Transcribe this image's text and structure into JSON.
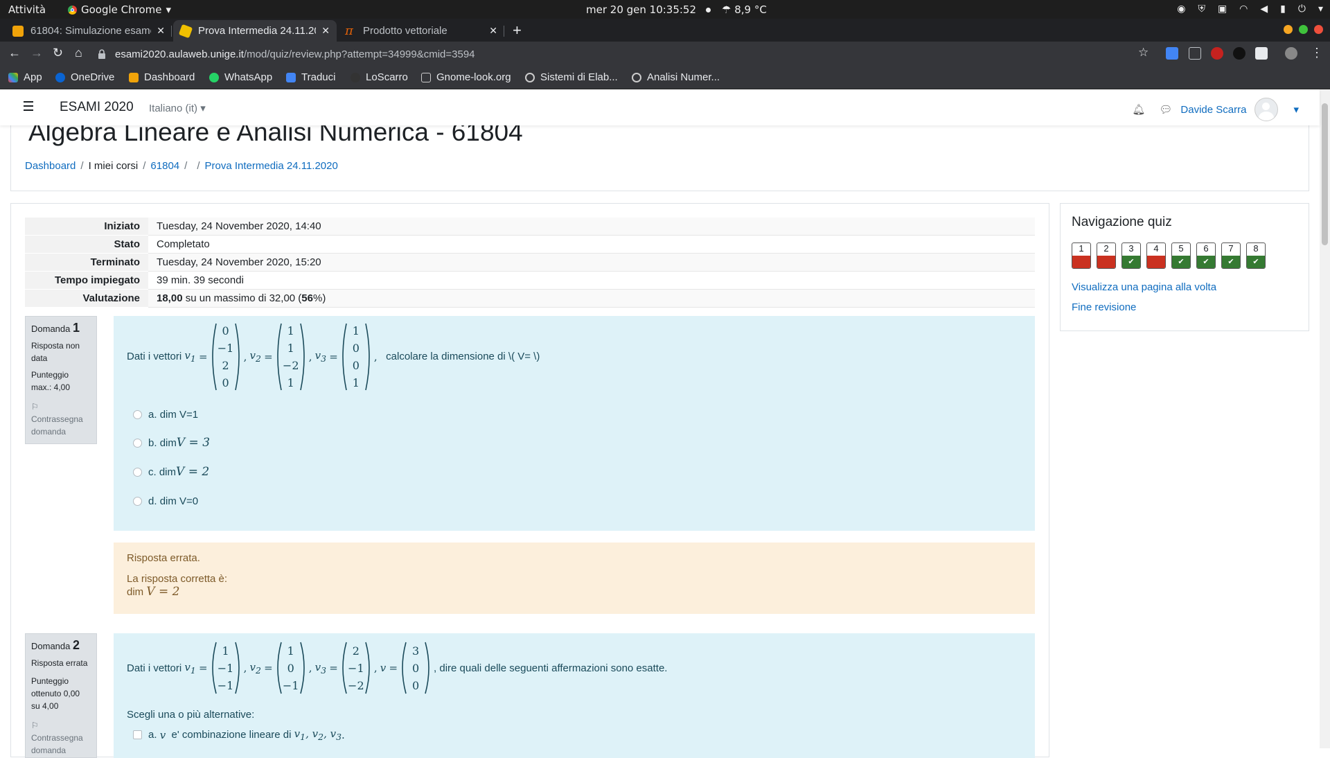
{
  "os": {
    "activities": "Attività",
    "app_name": "Google Chrome",
    "clock": "mer 20 gen  10:35:52",
    "weather": "8,9 °C"
  },
  "tabs": [
    {
      "title": "61804: Simulazione esame",
      "favicon_color": "#f0a30a",
      "active": false
    },
    {
      "title": "Prova Intermedia 24.11.2020",
      "favicon_color": "#f0c000",
      "active": true
    },
    {
      "title": "Prodotto vettoriale",
      "favicon_color": "#e36209",
      "active": false
    }
  ],
  "url": {
    "host": "esami2020.aulaweb.unige.it",
    "path": "/mod/quiz/review.php?attempt=34999&cmid=3594"
  },
  "bookmarks": [
    {
      "label": "App",
      "color": "#ea4335"
    },
    {
      "label": "OneDrive",
      "color": "#0a64d2"
    },
    {
      "label": "Dashboard",
      "color": "#f0a30a"
    },
    {
      "label": "WhatsApp",
      "color": "#25d366"
    },
    {
      "label": "Traduci",
      "color": "#4285f4"
    },
    {
      "label": "LoScarro",
      "color": "#333333"
    },
    {
      "label": "Gnome-look.org",
      "color": "#cccccc"
    },
    {
      "label": "Sistemi di Elab...",
      "color": "#cccccc"
    },
    {
      "label": "Analisi Numer...",
      "color": "#cccccc"
    }
  ],
  "moodle": {
    "site_name": "ESAMI 2020",
    "language": "Italiano (it)",
    "user_name": "Davide Scarra"
  },
  "page": {
    "title": "Algebra Lineare e Analisi Numerica - 61804",
    "breadcrumb": [
      "Dashboard",
      "I miei corsi",
      "61804",
      "",
      "Prova Intermedia 24.11.2020"
    ]
  },
  "summary": [
    {
      "label": "Iniziato",
      "value": "Tuesday, 24 November 2020, 14:40"
    },
    {
      "label": "Stato",
      "value": "Completato"
    },
    {
      "label": "Terminato",
      "value": "Tuesday, 24 November 2020, 15:20"
    },
    {
      "label": "Tempo impiegato",
      "value": "39 min. 39 secondi"
    },
    {
      "label": "Valutazione",
      "score": "18,00",
      "mid": " su un massimo di 32,00 (",
      "percent": "56",
      "end": "%)"
    }
  ],
  "q1": {
    "label": "Domanda",
    "number": "1",
    "status": "Risposta non data",
    "points": "Punteggio max.: 4,00",
    "flag": "Contrassegna domanda",
    "intro": "Dati i vettori",
    "v1": [
      "0",
      "−1",
      "2",
      "0"
    ],
    "v2": [
      "1",
      "1",
      "−2",
      "1"
    ],
    "v3": [
      "1",
      "0",
      "0",
      "1"
    ],
    "tail": "calcolare la dimensione di \\( V= \\)",
    "options": [
      {
        "letter": "a.",
        "text": "dim V=1",
        "math": ""
      },
      {
        "letter": "b.",
        "text": "dim ",
        "math": "V = 3"
      },
      {
        "letter": "c.",
        "text": "dim ",
        "math": "V = 2"
      },
      {
        "letter": "d.",
        "text": "dim V=0",
        "math": ""
      }
    ],
    "feedback": "Risposta errata.",
    "correct_label": "La risposta corretta è:",
    "correct_text": "dim ",
    "correct_math": "V = 2"
  },
  "q2": {
    "label": "Domanda",
    "number": "2",
    "status": "Risposta errata",
    "points": "Punteggio ottenuto 0,00 su 4,00",
    "flag": "Contrassegna domanda",
    "intro": "Dati i vettori",
    "v1": [
      "1",
      "−1",
      "−1"
    ],
    "v2": [
      "1",
      "0",
      "−1"
    ],
    "v3": [
      "2",
      "−1",
      "−2"
    ],
    "v": [
      "3",
      "0",
      "0"
    ],
    "tail": ", dire quali delle seguenti affermazioni sono esatte.",
    "prompt": "Scegli una o più alternative:",
    "option_a_letter": "a.",
    "option_a_text": "e' combinazione lineare di"
  },
  "quiz_nav": {
    "title": "Navigazione quiz",
    "buttons": [
      {
        "n": "1",
        "state": "incorrect"
      },
      {
        "n": "2",
        "state": "incorrect"
      },
      {
        "n": "3",
        "state": "correct"
      },
      {
        "n": "4",
        "state": "incorrect"
      },
      {
        "n": "5",
        "state": "correct"
      },
      {
        "n": "6",
        "state": "correct"
      },
      {
        "n": "7",
        "state": "correct"
      },
      {
        "n": "8",
        "state": "correct"
      }
    ],
    "colors": {
      "incorrect": "#ca3120",
      "correct": "#357a32"
    },
    "link_page": "Visualizza una pagina alla volta",
    "link_end": "Fine revisione"
  }
}
